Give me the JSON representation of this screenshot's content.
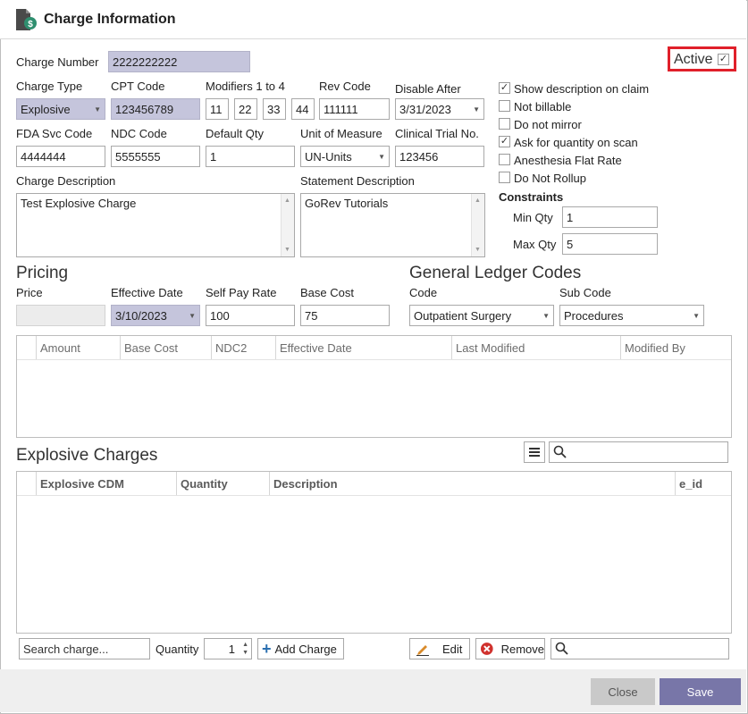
{
  "window": {
    "title": "Charge Information"
  },
  "active": {
    "label": "Active",
    "checked": true
  },
  "charge_number": {
    "label": "Charge Number",
    "value": "2222222222"
  },
  "fields": {
    "charge_type": {
      "label": "Charge Type",
      "value": "Explosive"
    },
    "cpt_code": {
      "label": "CPT Code",
      "value": "123456789"
    },
    "modifiers": {
      "label": "Modifiers 1 to 4",
      "values": [
        "11",
        "22",
        "33",
        "44"
      ]
    },
    "rev_code": {
      "label": "Rev Code",
      "value": "111111"
    },
    "disable_after": {
      "label": "Disable After",
      "value": "3/31/2023"
    },
    "fda_svc_code": {
      "label": "FDA Svc Code",
      "value": "4444444"
    },
    "ndc_code": {
      "label": "NDC Code",
      "value": "5555555"
    },
    "default_qty": {
      "label": "Default Qty",
      "value": "1"
    },
    "unit_of_measure": {
      "label": "Unit of Measure",
      "value": "UN-Units"
    },
    "clinical_trial_no": {
      "label": "Clinical Trial No.",
      "value": "123456"
    },
    "charge_description": {
      "label": "Charge Description",
      "value": "Test Explosive Charge"
    },
    "statement_description": {
      "label": "Statement Description",
      "value": "GoRev Tutorials"
    }
  },
  "options": [
    {
      "label": "Show description on claim",
      "checked": true
    },
    {
      "label": "Not billable",
      "checked": false
    },
    {
      "label": "Do not mirror",
      "checked": false
    },
    {
      "label": "Ask for quantity on scan",
      "checked": true
    },
    {
      "label": "Anesthesia Flat Rate",
      "checked": false
    },
    {
      "label": "Do Not Rollup",
      "checked": false
    }
  ],
  "constraints": {
    "title": "Constraints",
    "min_qty": {
      "label": "Min Qty",
      "value": "1"
    },
    "max_qty": {
      "label": "Max Qty",
      "value": "5"
    }
  },
  "pricing": {
    "title": "Pricing",
    "price": {
      "label": "Price",
      "value": ""
    },
    "effective_date": {
      "label": "Effective Date",
      "value": "3/10/2023"
    },
    "self_pay_rate": {
      "label": "Self Pay Rate",
      "value": "100"
    },
    "base_cost": {
      "label": "Base Cost",
      "value": "75"
    }
  },
  "gl_codes": {
    "title": "General Ledger Codes",
    "code": {
      "label": "Code",
      "value": "Outpatient Surgery"
    },
    "sub_code": {
      "label": "Sub Code",
      "value": "Procedures"
    }
  },
  "pricing_grid": {
    "columns": [
      "Amount",
      "Base Cost",
      "NDC2",
      "Effective Date",
      "Last Modified",
      "Modified By"
    ]
  },
  "explosive": {
    "title": "Explosive Charges",
    "columns": [
      "Explosive CDM",
      "Quantity",
      "Description",
      "e_id"
    ],
    "search_charge_placeholder": "Search charge...",
    "quantity_label": "Quantity",
    "quantity_value": "1",
    "add_charge": "Add Charge",
    "edit": "Edit",
    "remove": "Remove"
  },
  "footer": {
    "close": "Close",
    "save": "Save"
  },
  "colors": {
    "readonly_bg": "#c5c5dc",
    "highlight_box": "#e0202a",
    "save_bg": "#7876a8",
    "close_bg": "#c9c9c9"
  }
}
